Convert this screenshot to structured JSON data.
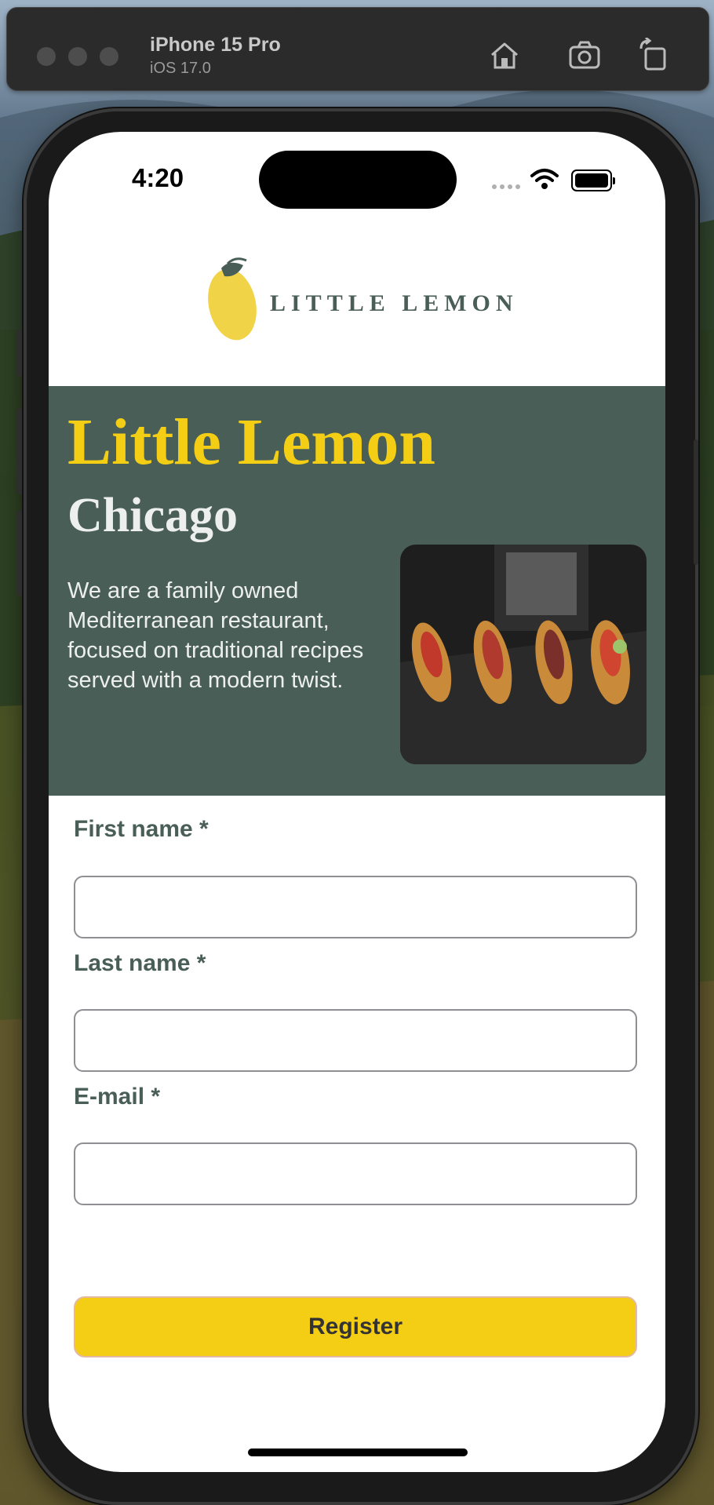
{
  "simulator": {
    "device_name": "iPhone 15 Pro",
    "os_version": "iOS 17.0",
    "icons": [
      "home-icon",
      "screenshot-icon",
      "rotate-icon"
    ]
  },
  "status_bar": {
    "time": "4:20",
    "icons": [
      "cellular-signal-icon",
      "wifi-icon",
      "battery-icon"
    ]
  },
  "header": {
    "logo_text": "LITTLE LEMON"
  },
  "hero": {
    "title": "Little Lemon",
    "city": "Chicago",
    "description": "We are a family owned Mediterranean restaurant, focused on traditional recipes served with a modern twist."
  },
  "form": {
    "first_name_label": "First name *",
    "first_name_value": "",
    "last_name_label": "Last name *",
    "last_name_value": "",
    "email_label": "E-mail *",
    "email_value": "",
    "register_label": "Register"
  },
  "colors": {
    "primary_green": "#495e57",
    "primary_yellow": "#f4ce14",
    "light_text": "#edefee"
  }
}
